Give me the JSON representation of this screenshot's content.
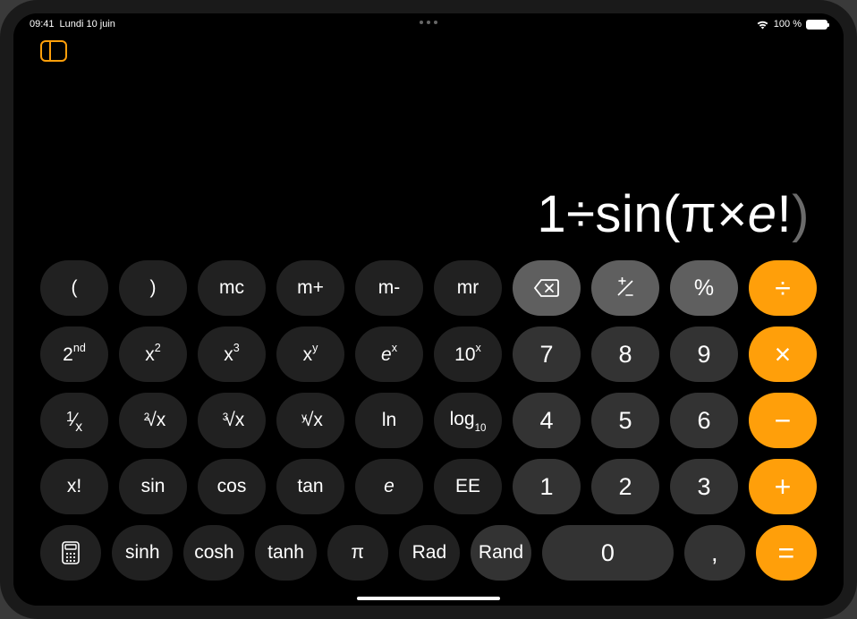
{
  "status": {
    "time": "09:41",
    "date": "Lundi 10 juin",
    "battery_text": "100 %"
  },
  "display": {
    "expr_pre": "1÷sin(π×",
    "expr_e": "e",
    "expr_post": "!",
    "expr_close": ")"
  },
  "keys": {
    "r1": {
      "lparen": "(",
      "rparen": ")",
      "mc": "mc",
      "mplus": "m+",
      "mminus": "m-",
      "mr": "mr",
      "backspace": "⌫",
      "sign": "+/-",
      "percent": "%",
      "divide": "÷"
    },
    "r2": {
      "second": "2",
      "second_sup": "nd",
      "x2_base": "x",
      "x2_sup": "2",
      "x3_base": "x",
      "x3_sup": "3",
      "xy_base": "x",
      "xy_sup": "y",
      "ex_base": "e",
      "ex_sup": "x",
      "tenx_base": "10",
      "tenx_sup": "x",
      "d7": "7",
      "d8": "8",
      "d9": "9",
      "multiply": "×"
    },
    "r3": {
      "recip_top": "1",
      "recip_bot": "x",
      "root2_deg": "2",
      "root2_rad": "√x",
      "root3_deg": "3",
      "root3_rad": "√x",
      "rooty_deg": "y",
      "rooty_rad": "√x",
      "ln": "ln",
      "log10_base": "log",
      "log10_sub": "10",
      "d4": "4",
      "d5": "5",
      "d6": "6",
      "minus": "−"
    },
    "r4": {
      "fact": "x!",
      "sin": "sin",
      "cos": "cos",
      "tan": "tan",
      "e": "e",
      "ee": "EE",
      "d1": "1",
      "d2": "2",
      "d3": "3",
      "plus": "+"
    },
    "r5": {
      "mode": "scientific-mode-icon",
      "sinh": "sinh",
      "cosh": "cosh",
      "tanh": "tanh",
      "pi": "π",
      "rad": "Rad",
      "rand": "Rand",
      "d0": "0",
      "decimal": ",",
      "equals": "="
    }
  }
}
